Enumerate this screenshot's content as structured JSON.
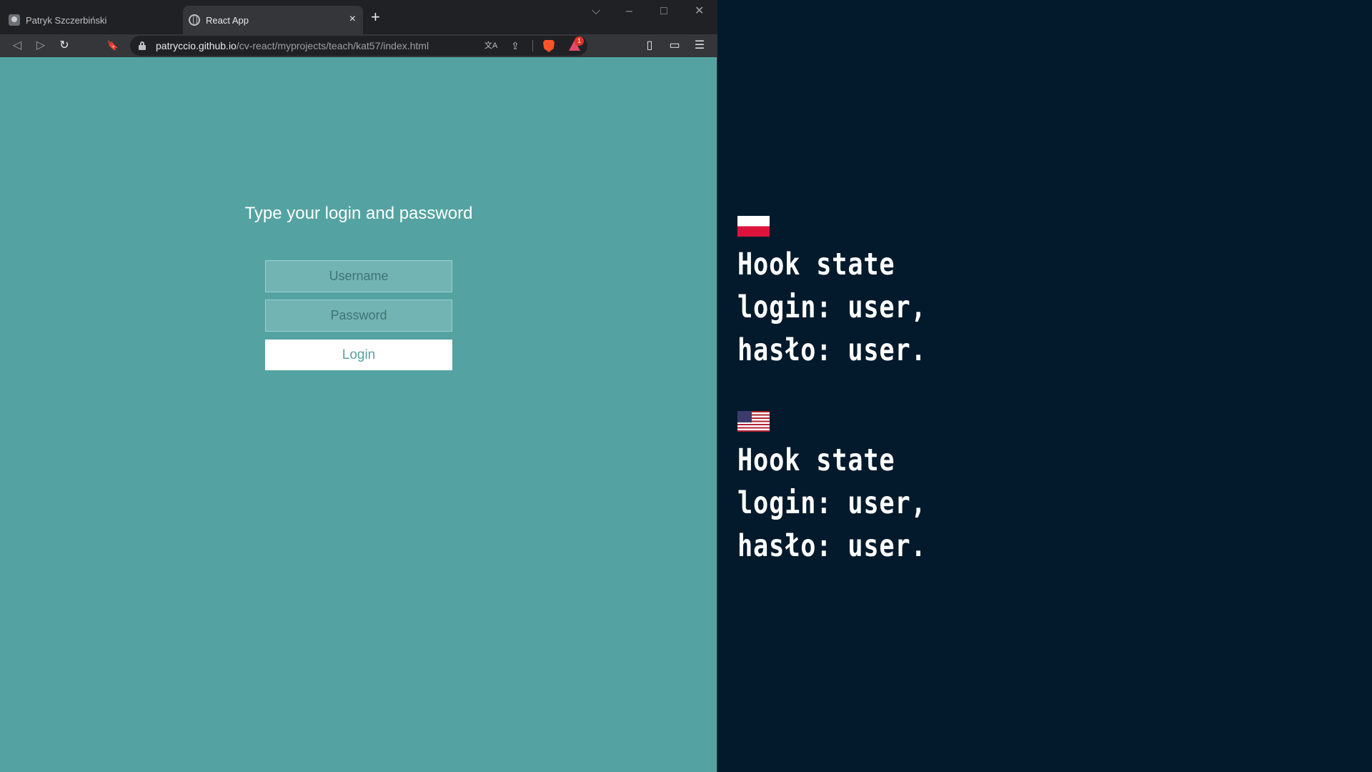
{
  "browser": {
    "tabs": [
      {
        "title": "Patryk Szczerbiński",
        "icon": "person-favicon",
        "active": false
      },
      {
        "title": "React App",
        "icon": "globe-favicon",
        "active": true
      }
    ],
    "tab_close": "×",
    "new_tab": "+",
    "window_controls": {
      "tab_search": "⌵",
      "minimize": "–",
      "maximize": "□",
      "close": "✕"
    },
    "nav": {
      "back": "◁",
      "forward": "▷",
      "reload": "↻",
      "bookmark": "🔖"
    },
    "url": {
      "host": "patryccio.github.io",
      "path": "/cv-react/myprojects/teach/kat57/index.html"
    },
    "omnibox_icons": {
      "translate": "文A",
      "share": "⇪"
    },
    "rewards_badge": "1",
    "right_icons": {
      "sidebar": "▯",
      "wallet": "▭",
      "menu": "☰"
    }
  },
  "login_form": {
    "title": "Type your login and password",
    "username_placeholder": "Username",
    "password_placeholder": "Password",
    "submit_label": "Login"
  },
  "info_panel": {
    "pl": {
      "flag": "poland-flag",
      "lines": [
        "Hook state",
        "login: user,",
        "hasło: user."
      ]
    },
    "en": {
      "flag": "usa-flag",
      "lines": [
        "Hook state",
        "login: user,",
        "hasło: user."
      ]
    }
  },
  "colors": {
    "page_bg": "#54a3a2",
    "panel_bg": "#021a2c",
    "accent_text": "#ffffff"
  }
}
